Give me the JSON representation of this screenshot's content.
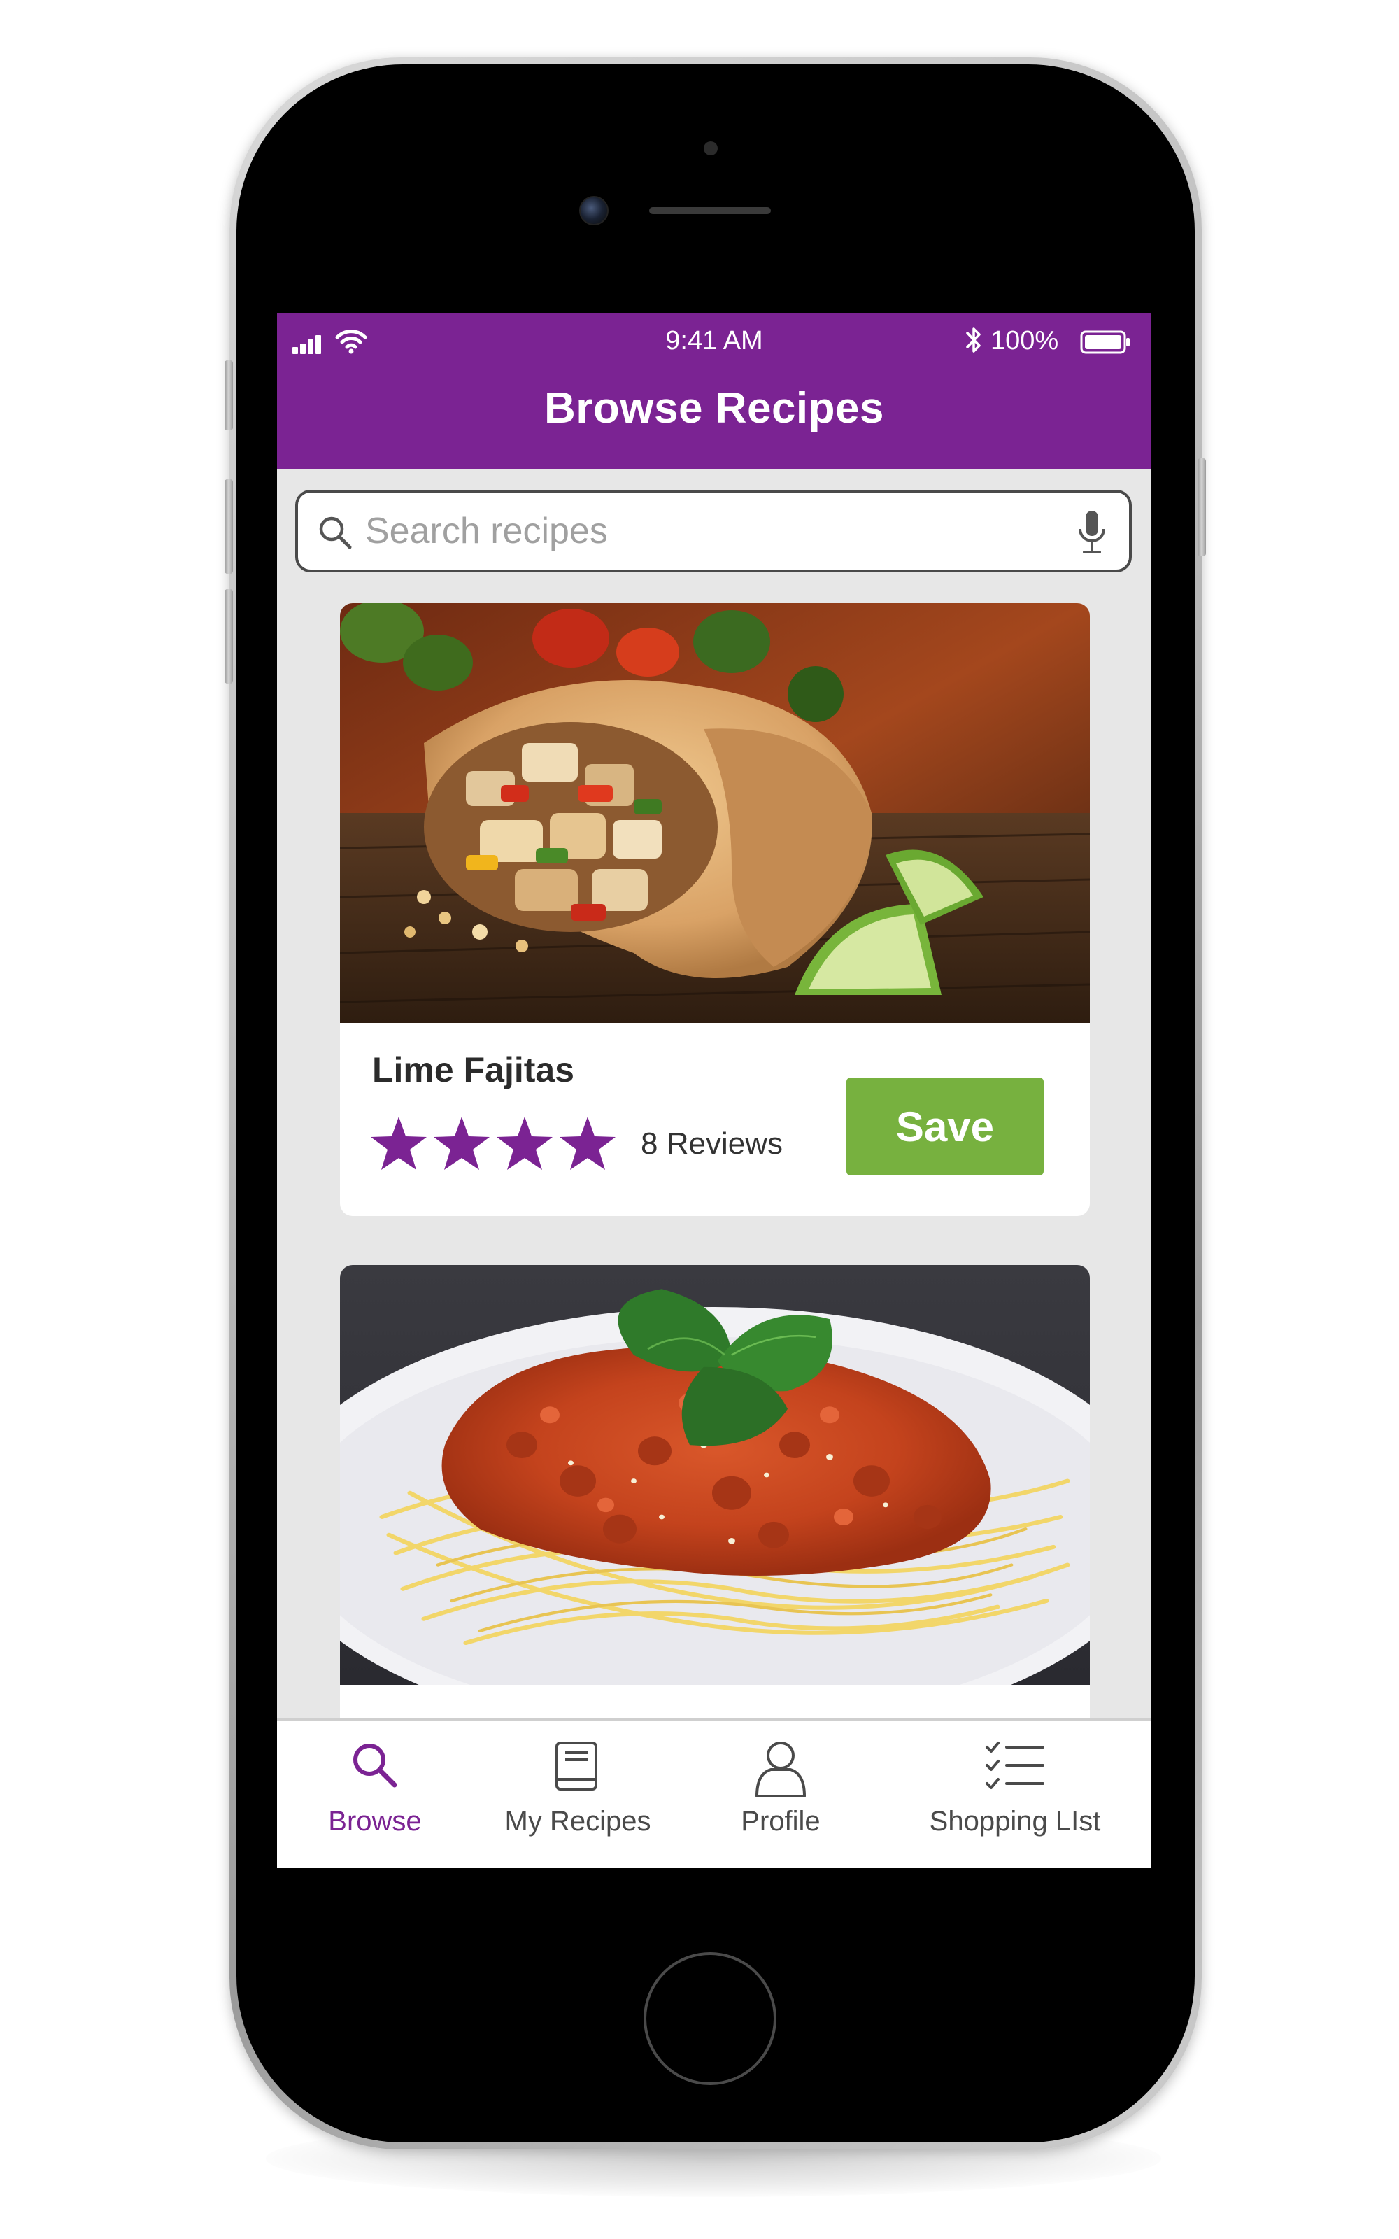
{
  "colors": {
    "brand_purple": "#7b2393",
    "save_green": "#77b13f",
    "screen_background": "#e7e7e7",
    "star_purple": "#7b2393"
  },
  "status_bar": {
    "time": "9:41 AM",
    "battery_percent": "100%",
    "icons": [
      "signal-icon",
      "wifi-icon",
      "bluetooth-icon",
      "battery-icon"
    ]
  },
  "header": {
    "title": "Browse Recipes"
  },
  "search": {
    "placeholder": "Search recipes",
    "value": "",
    "icons": [
      "search-icon",
      "mic-icon"
    ]
  },
  "recipes": [
    {
      "title": "Lime Fajitas",
      "rating": 4,
      "reviews": "8 Reviews",
      "save_label": "Save",
      "image": "photo of a chicken fajita wrap with lime wedges"
    },
    {
      "image": "photo of spaghetti bolognese with basil"
    }
  ],
  "tab_bar": {
    "active": "Browse",
    "tabs": [
      {
        "label": "Browse",
        "icon": "search-icon"
      },
      {
        "label": "My Recipes",
        "icon": "book-icon"
      },
      {
        "label": "Profile",
        "icon": "person-icon"
      },
      {
        "label": "Shopping LIst",
        "icon": "checklist-icon"
      }
    ]
  }
}
